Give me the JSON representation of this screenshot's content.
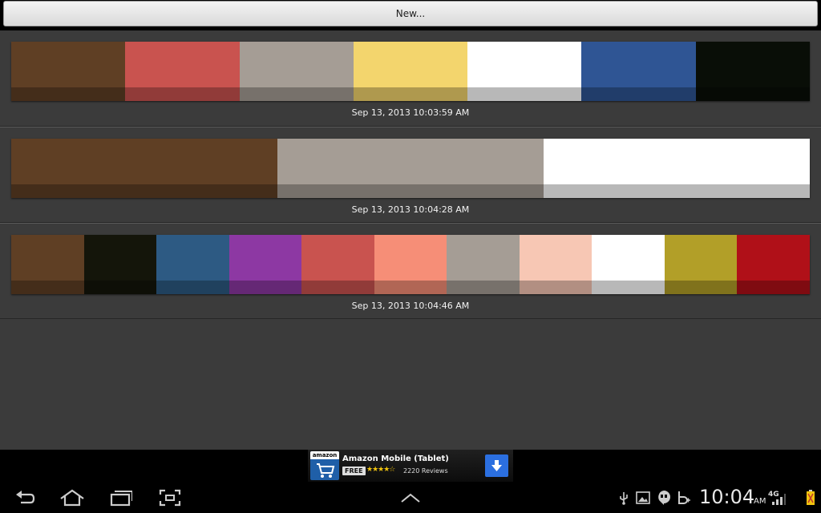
{
  "toolbar": {
    "new_label": "New..."
  },
  "palettes": [
    {
      "timestamp": "Sep 13, 2013 10:03:59 AM",
      "colors": [
        "#5f3f24",
        "#c9534f",
        "#a59d95",
        "#f3d56d",
        "#ffffff",
        "#2f5594",
        "#090e07"
      ]
    },
    {
      "timestamp": "Sep 13, 2013 10:04:28 AM",
      "colors": [
        "#5f3f24",
        "#a59d95",
        "#ffffff"
      ]
    },
    {
      "timestamp": "Sep 13, 2013 10:04:46 AM",
      "colors": [
        "#5f3f24",
        "#14150a",
        "#2d5a83",
        "#8d38a3",
        "#c9534f",
        "#f68e77",
        "#a59d95",
        "#f7c7b4",
        "#ffffff",
        "#b29f28",
        "#b01018"
      ]
    }
  ],
  "ad": {
    "brand": "amazon",
    "title": "Amazon Mobile (Tablet)",
    "badge": "FREE",
    "stars": "★★★★☆",
    "reviews": "2220 Reviews"
  },
  "status": {
    "time": "10:04",
    "ampm": "AM",
    "network": "4G"
  },
  "icons": {
    "back": "back-icon",
    "home": "home-icon",
    "recents": "recent-apps-icon",
    "screenshot": "screenshot-icon",
    "up": "chevron-up-icon"
  }
}
